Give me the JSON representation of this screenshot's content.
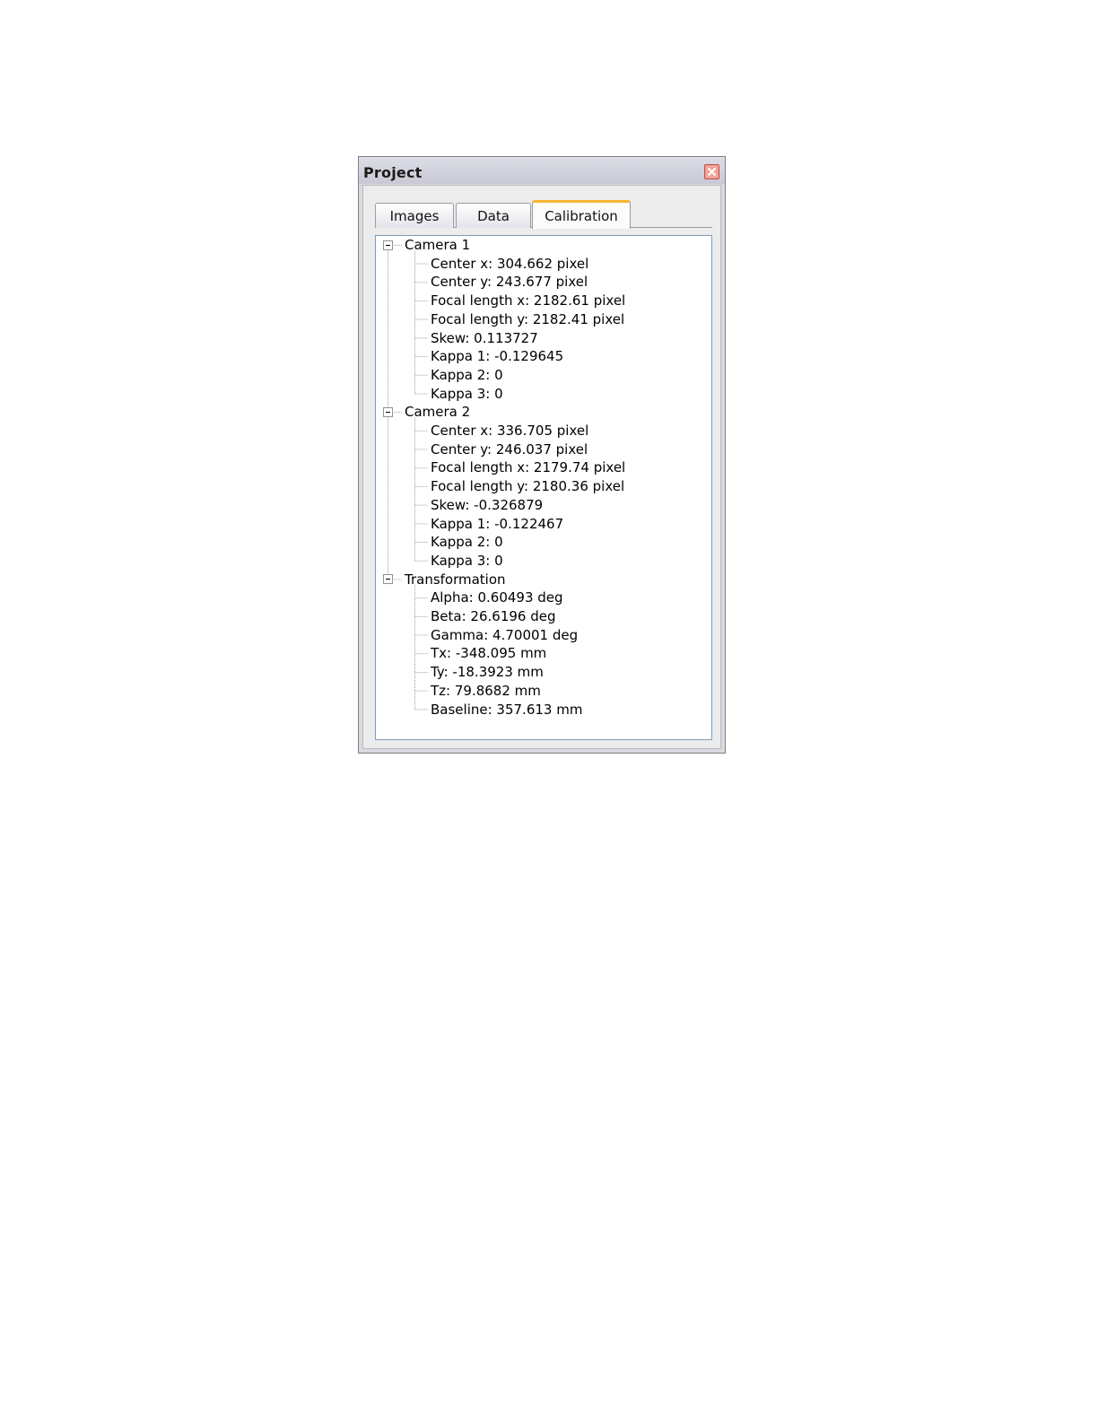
{
  "window": {
    "title": "Project",
    "close_icon": "close-icon",
    "accent_color": "#f7b432"
  },
  "tabs": [
    {
      "label": "Images",
      "active": false
    },
    {
      "label": "Data",
      "active": false
    },
    {
      "label": "Calibration",
      "active": true
    }
  ],
  "tree": {
    "camera1": {
      "label": "Camera 1",
      "expanded": true,
      "items": [
        "Center x: 304.662 pixel",
        "Center y: 243.677 pixel",
        "Focal length x: 2182.61 pixel",
        "Focal length y: 2182.41 pixel",
        "Skew: 0.113727",
        "Kappa 1: -0.129645",
        "Kappa 2: 0",
        "Kappa 3: 0"
      ]
    },
    "camera2": {
      "label": "Camera 2",
      "expanded": true,
      "items": [
        "Center x: 336.705 pixel",
        "Center y: 246.037 pixel",
        "Focal length x: 2179.74 pixel",
        "Focal length y: 2180.36 pixel",
        "Skew: -0.326879",
        "Kappa 1: -0.122467",
        "Kappa 2: 0",
        "Kappa 3: 0"
      ]
    },
    "transformation": {
      "label": "Transformation",
      "expanded": true,
      "items": [
        "Alpha: 0.60493 deg",
        "Beta: 26.6196 deg",
        "Gamma: 4.70001 deg",
        "Tx: -348.095 mm",
        "Ty: -18.3923 mm",
        "Tz: 79.8682 mm",
        "Baseline: 357.613 mm"
      ]
    }
  }
}
